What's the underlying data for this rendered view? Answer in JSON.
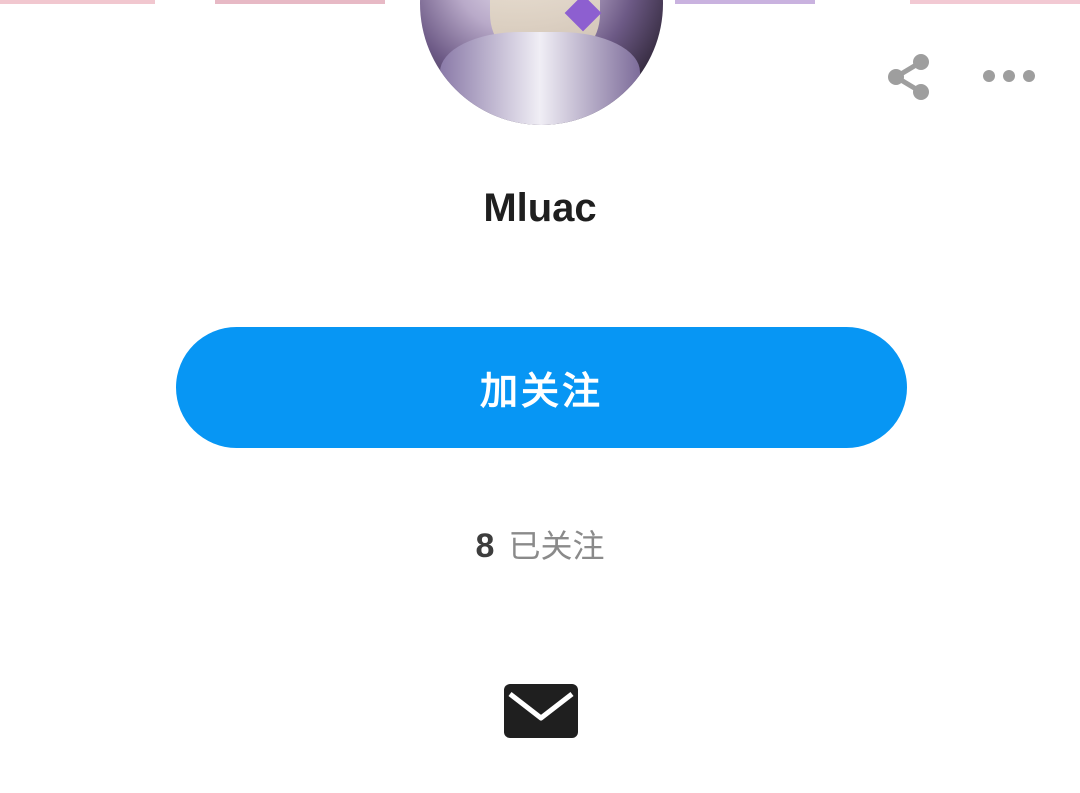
{
  "header": {
    "cover_colors": [
      "#f1c7cf",
      "#ffffff",
      "#e7b9c5",
      "#ffffff",
      "#c9b2df",
      "#ffffff",
      "#f2c9d3"
    ],
    "share_icon": "share-icon",
    "more_icon": "more-horizontal-icon"
  },
  "profile": {
    "avatar_icon": "avatar-image",
    "username": "Mluac"
  },
  "actions": {
    "follow_label": "加关注",
    "follow_color": "#0796f4"
  },
  "stats": {
    "following_count": "8",
    "following_label": "已关注"
  },
  "message": {
    "icon": "envelope-icon"
  }
}
